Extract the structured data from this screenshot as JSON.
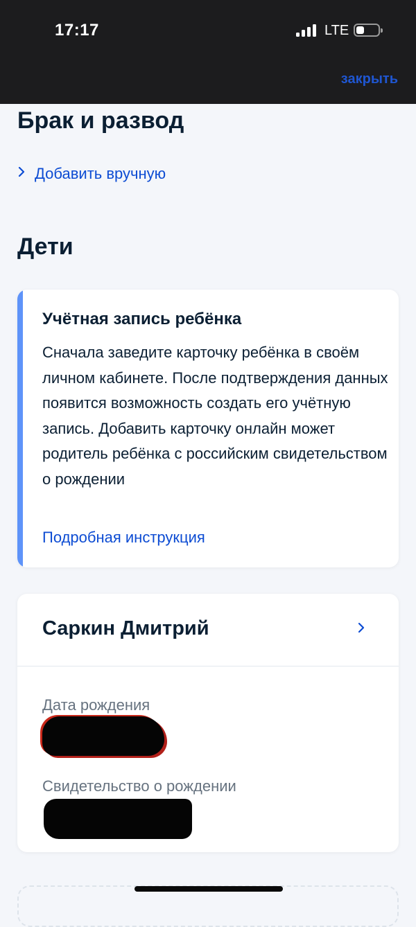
{
  "status_bar": {
    "time": "17:17",
    "network": "LTE"
  },
  "header": {
    "close_label": "закрыть"
  },
  "marriage": {
    "title": "Брак и развод",
    "add_manual_label": "Добавить вручную"
  },
  "children": {
    "title": "Дети",
    "info_card": {
      "title": "Учётная запись ребёнка",
      "body": "Сначала заведите карточку ребёнка в своём личном кабинете. После подтверждения данных появится возможность создать его учётную запись. Добавить карточку онлайн может родитель ребёнка с российским свидетельством о рождении",
      "link_label": "Подробная инструкция"
    },
    "child_card": {
      "name": "Саркин Дмитрий",
      "birth_date_label": "Дата рождения",
      "birth_certificate_label": "Свидетельство о рождении"
    }
  },
  "colors": {
    "accent": "#0d4cd3",
    "info_stripe": "#5e93f9",
    "status_bar_bg": "#1c1c1e"
  }
}
